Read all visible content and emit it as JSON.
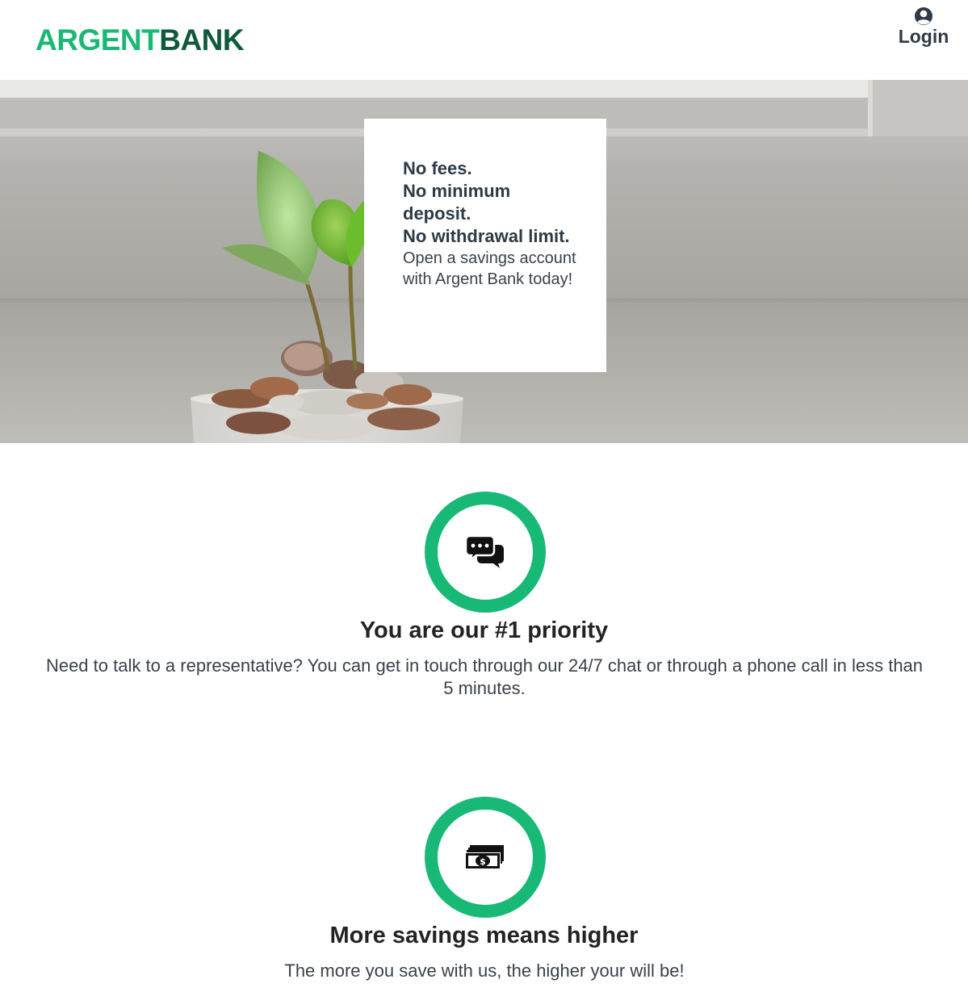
{
  "brand": {
    "name_part1": "ARGENT",
    "name_part2": "BANK",
    "accent_color": "#19b873",
    "dark_color": "#0f5a3a"
  },
  "header": {
    "login_label": "Login",
    "login_icon": "user-circle-icon"
  },
  "hero": {
    "image": "plant-growing-from-coins-in-glass",
    "card": {
      "lines": [
        "No fees.",
        "No minimum deposit.",
        "No withdrawal limit."
      ],
      "text": "Open a savings account with Argent Bank today!"
    }
  },
  "features": [
    {
      "icon": "chat-bubbles-icon",
      "title": "You are our #1 priority",
      "text": "Need to talk to a representative? You can get in touch through our 24/7 chat or through a phone call in less than 5 minutes."
    },
    {
      "icon": "money-bills-icon",
      "title": "More savings means higher",
      "text": "The more you save with us, the higher your will be!"
    }
  ]
}
